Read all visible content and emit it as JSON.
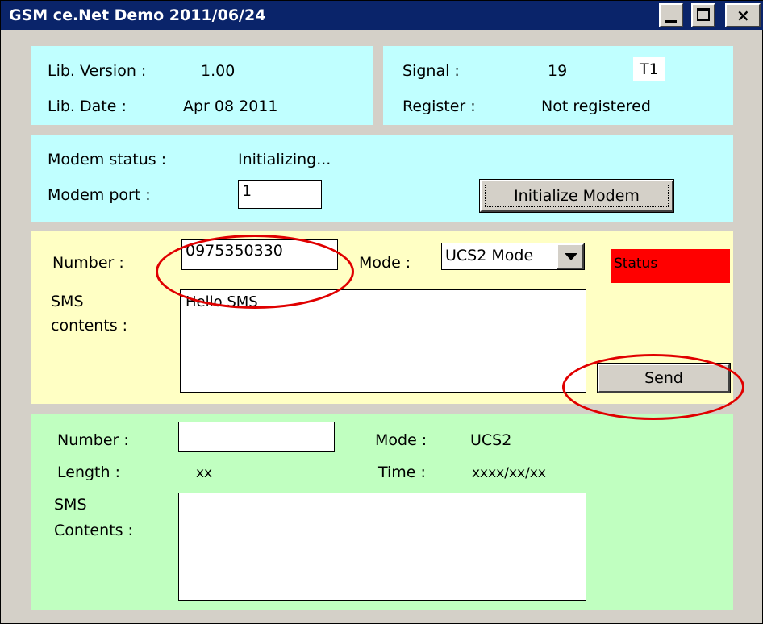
{
  "window": {
    "title": "GSM ce.Net Demo 2011/06/24"
  },
  "library": {
    "version_label": "Lib. Version :",
    "version_value": "1.00",
    "date_label": "Lib. Date :",
    "date_value": "Apr 08 2011"
  },
  "signal": {
    "signal_label": "Signal :",
    "signal_value": "19",
    "signal_badge": "T1",
    "register_label": "Register :",
    "register_value": "Not registered"
  },
  "modem": {
    "status_label": "Modem status :",
    "status_value": "Initializing...",
    "port_label": "Modem port :",
    "port_value": "1",
    "init_button": "Initialize Modem"
  },
  "send_sms": {
    "number_label": "Number :",
    "number_value": "0975350330",
    "mode_label": "Mode :",
    "mode_value": "UCS2 Mode",
    "status_text": "Status",
    "contents_label_line1": "SMS",
    "contents_label_line2": "contents :",
    "contents_value": "Hello SMS",
    "send_button": "Send"
  },
  "received_sms": {
    "number_label": "Number :",
    "number_value": "",
    "mode_label": "Mode :",
    "mode_value": "UCS2",
    "length_label": "Length :",
    "length_value": "xx",
    "time_label": "Time :",
    "time_value": "xxxx/xx/xx",
    "contents_label_line1": "SMS",
    "contents_label_line2": "Contents :",
    "contents_value": ""
  },
  "colors": {
    "titlebar": "#0a246a",
    "panel_cyan": "#c0ffff",
    "panel_yellow": "#ffffc4",
    "panel_green": "#c0ffc0",
    "status_red": "#ff0000",
    "annotation_red": "#e00000"
  }
}
